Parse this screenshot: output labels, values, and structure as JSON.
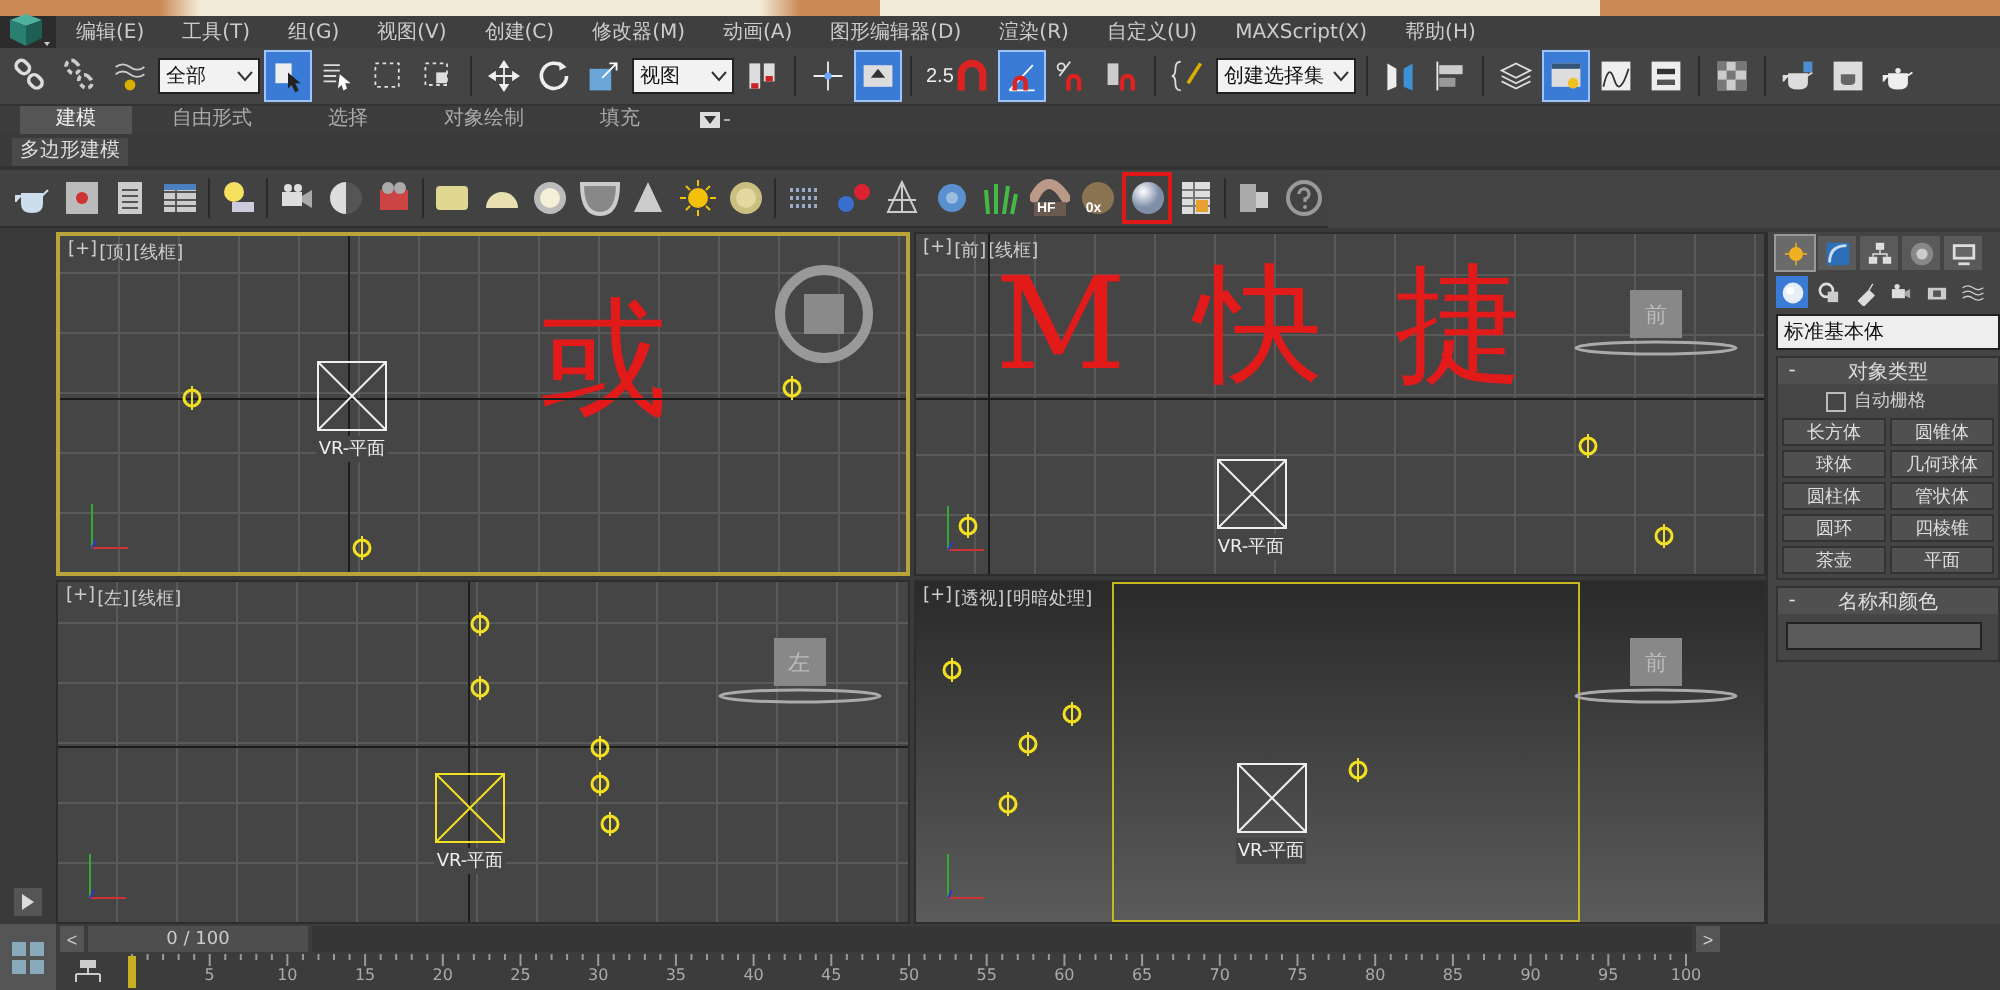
{
  "menu": [
    "编辑(E)",
    "工具(T)",
    "组(G)",
    "视图(V)",
    "创建(C)",
    "修改器(M)",
    "动画(A)",
    "图形编辑器(D)",
    "渲染(R)",
    "自定义(U)",
    "MAXScript(X)",
    "帮助(H)"
  ],
  "main_toolbar": [
    {
      "kind": "link",
      "on": false
    },
    {
      "kind": "unlink",
      "on": false
    },
    {
      "kind": "bind",
      "on": false
    },
    {
      "kind": "dropdown",
      "value": "全部"
    },
    {
      "kind": "select",
      "on": true
    },
    {
      "kind": "select-name",
      "on": false
    },
    {
      "kind": "region",
      "on": false
    },
    {
      "kind": "crossing",
      "on": false
    },
    {
      "kind": "sep"
    },
    {
      "kind": "move",
      "on": false
    },
    {
      "kind": "rotate",
      "on": false
    },
    {
      "kind": "scale",
      "on": false
    },
    {
      "kind": "dropdown",
      "value": "视图"
    },
    {
      "kind": "pivot",
      "on": false
    },
    {
      "kind": "sep"
    },
    {
      "kind": "manipulate",
      "on": false
    },
    {
      "kind": "keyboard",
      "on": true
    },
    {
      "kind": "sep"
    },
    {
      "kind": "snap",
      "label": "2.5",
      "on": false
    },
    {
      "kind": "angle",
      "on": true
    },
    {
      "kind": "percent",
      "on": false
    },
    {
      "kind": "spinner",
      "on": false
    },
    {
      "kind": "sep"
    },
    {
      "kind": "abc",
      "on": false
    },
    {
      "kind": "dropdown",
      "value": "创建选择集"
    },
    {
      "kind": "sep"
    },
    {
      "kind": "mirror",
      "on": false
    },
    {
      "kind": "align",
      "on": false
    },
    {
      "kind": "sep"
    },
    {
      "kind": "layer",
      "on": false
    },
    {
      "kind": "explorer",
      "on": true
    },
    {
      "kind": "curve",
      "on": false
    },
    {
      "kind": "schematic",
      "on": false
    },
    {
      "kind": "sep"
    },
    {
      "kind": "material",
      "on": false
    },
    {
      "kind": "sep"
    },
    {
      "kind": "render-setup",
      "on": false
    },
    {
      "kind": "frame",
      "on": false
    },
    {
      "kind": "render",
      "on": false
    }
  ],
  "ribbon_tabs": [
    {
      "label": "建模",
      "selected": true
    },
    {
      "label": "自由形式",
      "selected": false
    },
    {
      "label": "选择",
      "selected": false
    },
    {
      "label": "对象绘制",
      "selected": false
    },
    {
      "label": "填充",
      "selected": false
    }
  ],
  "ribbon_panel": "多边形建模",
  "secondary_toolbar": [
    {
      "kind": "teapot",
      "marked": false
    },
    {
      "kind": "window",
      "marked": false
    },
    {
      "kind": "panel",
      "marked": false
    },
    {
      "kind": "table",
      "marked": false
    },
    {
      "kind": "sep"
    },
    {
      "kind": "bulb",
      "marked": false
    },
    {
      "kind": "sep"
    },
    {
      "kind": "camera",
      "marked": false
    },
    {
      "kind": "moon",
      "marked": false
    },
    {
      "kind": "projector",
      "marked": false
    },
    {
      "kind": "sep"
    },
    {
      "kind": "plane",
      "marked": false
    },
    {
      "kind": "dome",
      "marked": false
    },
    {
      "kind": "disc",
      "marked": false
    },
    {
      "kind": "bowl",
      "marked": false
    },
    {
      "kind": "cone",
      "marked": false
    },
    {
      "kind": "sun",
      "marked": false
    },
    {
      "kind": "ring",
      "marked": false
    },
    {
      "kind": "sep"
    },
    {
      "kind": "fur",
      "marked": false
    },
    {
      "kind": "atoms",
      "marked": false
    },
    {
      "kind": "bench",
      "marked": false
    },
    {
      "kind": "blob",
      "marked": false
    },
    {
      "kind": "grass",
      "marked": false
    },
    {
      "kind": "hf",
      "label": "HF",
      "marked": false
    },
    {
      "kind": "ox",
      "label": "0x",
      "marked": false
    },
    {
      "kind": "sphere",
      "marked": true
    },
    {
      "kind": "scenelist",
      "marked": false
    },
    {
      "kind": "sep"
    },
    {
      "kind": "convert",
      "marked": false
    },
    {
      "kind": "help",
      "marked": false
    }
  ],
  "viewports": [
    {
      "labels": [
        "[+]",
        "[顶]",
        "[线框]"
      ],
      "kind": "wireframe",
      "selected": true,
      "object_label": "VR-平面",
      "annotations": [
        "或"
      ]
    },
    {
      "labels": [
        "[+]",
        "[前]",
        "[线框]"
      ],
      "kind": "wireframe",
      "selected": false,
      "object_label": "VR-平面",
      "cube_label": "前",
      "annotations": [
        "M",
        "快",
        "捷"
      ]
    },
    {
      "labels": [
        "[+]",
        "[左]",
        "[线框]"
      ],
      "kind": "wireframe",
      "selected": false,
      "object_label": "VR-平面",
      "cube_label": "左"
    },
    {
      "labels": [
        "[+]",
        "[透视]",
        "[明暗处理]"
      ],
      "kind": "shaded",
      "selected": false,
      "object_label": "VR-平面",
      "cube_label": "前"
    }
  ],
  "command_panel": {
    "tabs": [
      {
        "kind": "create",
        "selected": true
      },
      {
        "kind": "modify",
        "selected": false
      },
      {
        "kind": "hierarchy",
        "selected": false
      },
      {
        "kind": "motion",
        "selected": false
      },
      {
        "kind": "display",
        "selected": false
      }
    ],
    "categories": [
      {
        "kind": "geometry",
        "selected": true
      },
      {
        "kind": "shapes",
        "selected": false
      },
      {
        "kind": "lights",
        "selected": false
      },
      {
        "kind": "cameras",
        "selected": false
      },
      {
        "kind": "helpers",
        "selected": false
      },
      {
        "kind": "spacewarps",
        "selected": false
      }
    ],
    "dropdown": "标准基本体",
    "object_type": {
      "title": "对象类型",
      "collapse": "-",
      "autogrid": {
        "label": "自动栅格",
        "checked": false
      },
      "buttons": [
        "长方体",
        "圆锥体",
        "球体",
        "几何球体",
        "圆柱体",
        "管状体",
        "圆环",
        "四棱锥",
        "茶壶",
        "平面"
      ]
    },
    "name_color": {
      "title": "名称和颜色",
      "collapse": "-"
    }
  },
  "time_slider": {
    "label": "0 / 100",
    "prev": "<",
    "next": ">"
  },
  "ruler_labels": [
    "5",
    "10",
    "15",
    "20",
    "25",
    "30",
    "35",
    "40",
    "45",
    "50",
    "55",
    "60",
    "65",
    "70",
    "75",
    "80",
    "85",
    "90",
    "95",
    "100"
  ]
}
